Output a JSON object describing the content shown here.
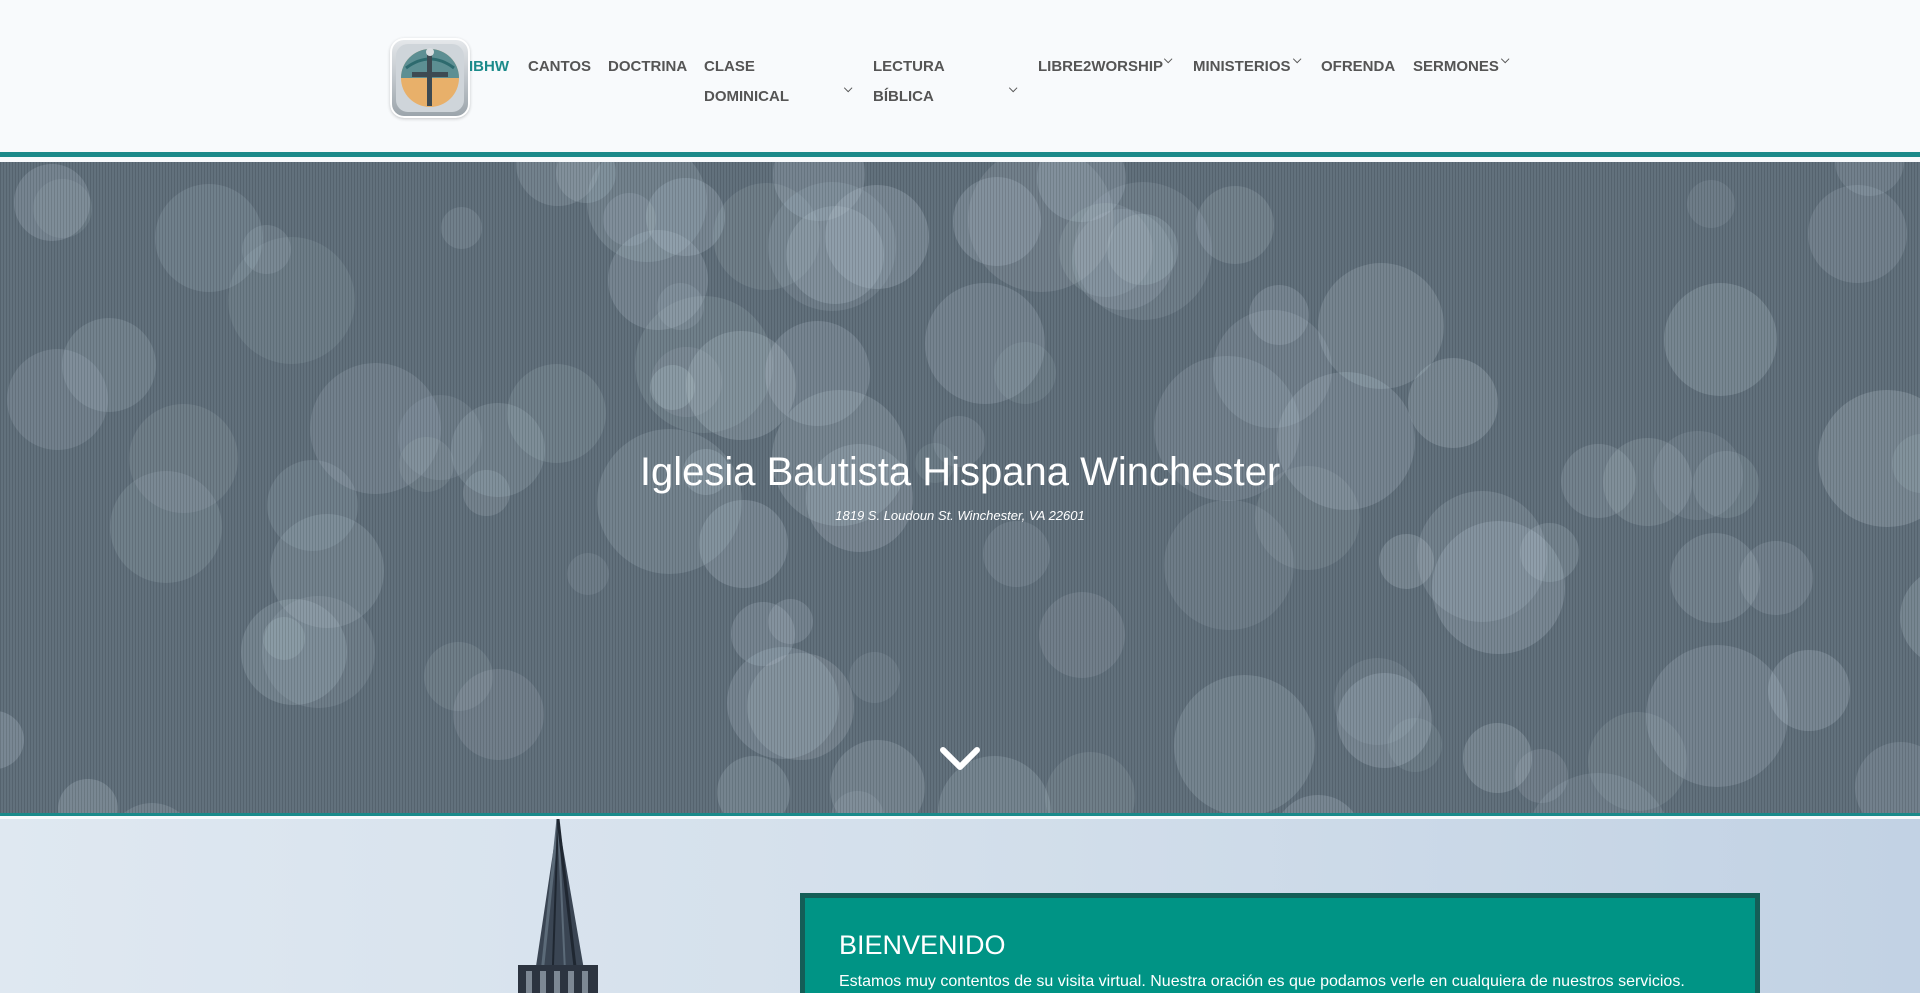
{
  "header": {
    "logo_icon": "church-cross-logo-icon",
    "accent_color": "#1b8a8a",
    "nav": [
      {
        "label": "IBHW",
        "active": true
      },
      {
        "label": "CANTOS"
      },
      {
        "label": "DOCTRINA"
      },
      {
        "label": "CLASE DOMINICAL",
        "dropdown": true
      },
      {
        "label": "LECTURA BÍBLICA",
        "dropdown": true
      },
      {
        "label": "LIBRE2WORSHIP",
        "dropdown": true
      },
      {
        "label": "MINISTERIOS",
        "dropdown": true
      },
      {
        "label": "OFRENDA"
      },
      {
        "label": "SERMONES",
        "dropdown": true
      }
    ]
  },
  "hero": {
    "title": "Iglesia Bautista Hispana Winchester",
    "address": "1819 S. Loudoun St. Winchester, VA 22601",
    "scroll_icon": "chevron-down-icon"
  },
  "welcome": {
    "heading": "BIENVENIDO",
    "text": "Estamos muy contentos de su visita virtual. Nuestra oración es que podamos verle en cualquiera de nuestros servicios.",
    "background_color": "#009485"
  }
}
